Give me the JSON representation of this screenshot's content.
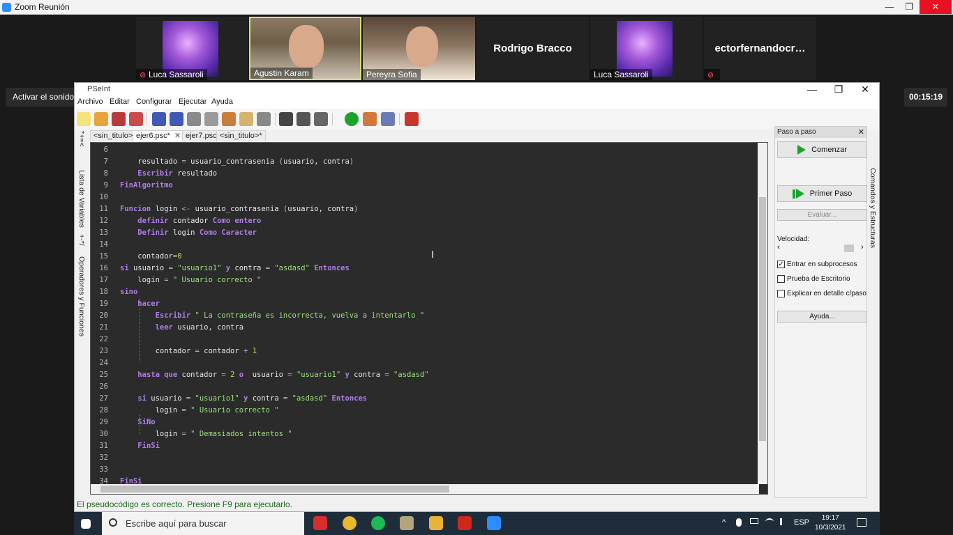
{
  "zoom": {
    "title": "Zoom Reunión",
    "win_buttons": {
      "minimize": "—",
      "maximize": "❐",
      "close": "✕"
    },
    "participants": [
      {
        "name": "Luca Sassaroli",
        "muted": true
      },
      {
        "name": "Agustin Karam",
        "muted": false
      },
      {
        "name": "Pereyra Sofia",
        "muted": false
      },
      {
        "name": "Rodrigo Bracco",
        "muted": false
      },
      {
        "name": "Luca Sassaroli",
        "muted": false
      },
      {
        "name": "ectorfernandocr…",
        "muted": true
      }
    ],
    "sound_button": "Activar el sonido original",
    "timer": "00:15:19"
  },
  "pseint": {
    "title": "PSeInt",
    "win_buttons": {
      "minimize": "—",
      "maximize": "❐",
      "close": "✕"
    },
    "menu": [
      "Archivo",
      "Editar",
      "Configurar",
      "Ejecutar",
      "Ayuda"
    ],
    "tabs": [
      "<sin_titulo>",
      "ejer6.psc*",
      "ejer7.psc",
      "<sin_titulo>*"
    ],
    "tab_close": "✕",
    "left_panel": [
      "Lista de Variables",
      "Operadores y Funciones"
    ],
    "left_panel_icons": [
      "*+=<",
      "+-*/"
    ],
    "right_vert_label": "Comandos y Estructuras",
    "status": "El pseudocódigo es correcto. Presione F9 para ejecutarlo.",
    "step_panel": {
      "title": "Paso a paso",
      "close": "✕",
      "start": "Comenzar",
      "first_step": "Primer Paso",
      "evaluate": "Evaluar...",
      "speed": "Velocidad:",
      "speed_left": "‹",
      "speed_right": "›",
      "options": [
        {
          "label": "Entrar en subprocesos",
          "checked": true
        },
        {
          "label": "Prueba de Escritorio",
          "checked": false
        },
        {
          "label": "Explicar en detalle c/paso",
          "checked": false
        }
      ],
      "help": "Ayuda..."
    },
    "code_lines": [
      {
        "n": "6"
      },
      {
        "n": "7"
      },
      {
        "n": "8"
      },
      {
        "n": "9"
      },
      {
        "n": "10"
      },
      {
        "n": "11"
      },
      {
        "n": "12"
      },
      {
        "n": "13"
      },
      {
        "n": "14"
      },
      {
        "n": "15"
      },
      {
        "n": "16"
      },
      {
        "n": "17"
      },
      {
        "n": "18"
      },
      {
        "n": "19"
      },
      {
        "n": "20"
      },
      {
        "n": "21"
      },
      {
        "n": "22"
      },
      {
        "n": "23"
      },
      {
        "n": "24"
      },
      {
        "n": "25"
      },
      {
        "n": "26"
      },
      {
        "n": "27"
      },
      {
        "n": "28"
      },
      {
        "n": "29"
      },
      {
        "n": "30"
      },
      {
        "n": "31"
      },
      {
        "n": "32"
      },
      {
        "n": "33"
      },
      {
        "n": "34"
      }
    ]
  },
  "taskbar": {
    "search_placeholder": "Escribe aquí para buscar",
    "lang": "ESP",
    "time": "19:17",
    "date": "10/3/2021",
    "tray_up": "^"
  }
}
